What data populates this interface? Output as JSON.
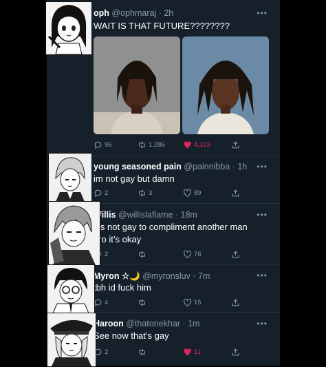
{
  "tweets": [
    {
      "name": "oph",
      "handle": "@ophmaraj",
      "time": "· 2h",
      "text": "WAIT IS THAT FUTURE????????",
      "replies": "96",
      "retweets": "1,286",
      "likes": "4,313",
      "liked": true
    },
    {
      "name": "young seasoned pain",
      "handle": "@painnibba",
      "time": "· 1h",
      "text": "im not gay but damn",
      "replies": "2",
      "retweets": "3",
      "likes": "89",
      "liked": false
    },
    {
      "name": "Willis",
      "handle": "@willislaflame",
      "time": "· 18m",
      "text": "It’s not gay to compliment another man\nbro it’s okay",
      "replies": "2",
      "retweets": "",
      "likes": "76",
      "liked": false
    },
    {
      "name": "Myron ☆🌙",
      "handle": "@myronsluv",
      "time": "· 7m",
      "text": "tbh id fuck him",
      "replies": "4",
      "retweets": "",
      "likes": "15",
      "liked": false
    },
    {
      "name": "Haroon",
      "handle": "@thatonekhar",
      "time": "· 1m",
      "text": "See now that’s gay",
      "replies": "2",
      "retweets": "",
      "likes": "11",
      "liked": true
    }
  ],
  "more_label": "•••",
  "icons": [
    "reply-icon",
    "retweet-icon",
    "like-icon",
    "share-icon",
    "more-icon"
  ],
  "colors": {
    "background": "#15202b",
    "secondary_text": "#8899a6",
    "like": "#e0245e"
  }
}
